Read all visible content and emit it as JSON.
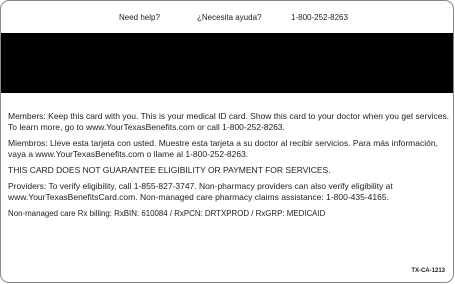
{
  "help": {
    "english": "Need help?",
    "spanish": "¿Necesita ayuda?",
    "phone": "1-800-252-8263"
  },
  "paragraphs": {
    "members": "Members: Keep this card with you. This is your medical ID card. Show this card to your doctor when you get services. To learn more, go to www.YourTexasBenefits.com or call 1-800-252-8263.",
    "miembros": "Miembros: Lleve esta tarjeta con usted. Muestre esta tarjeta a su doctor al recibir servicios. Para más información, vaya a www.YourTexasBenefits.com o llame al 1-800-252-8263.",
    "disclaimer": "THIS CARD DOES NOT GUARANTEE ELIGIBILITY OR PAYMENT FOR SERVICES.",
    "providers": "Providers: To verify eligibility, call 1-855-827-3747. Non-pharmacy providers can also verify eligibility at www.YourTexasBenefitsCard.com. Non-managed care pharmacy claims assistance: 1-800-435-4165.",
    "rx_billing": "Non-managed care Rx billing: RxBIN: 610084 / RxPCN: DRTXPROD / RxGRP: MEDICAID"
  },
  "card_code": "TX-CA-1213"
}
